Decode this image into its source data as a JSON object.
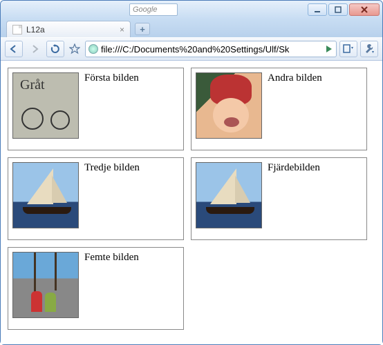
{
  "window": {
    "search_placeholder": "Google"
  },
  "tab": {
    "title": "L12a"
  },
  "toolbar": {
    "url": "file:///C:/Documents%20and%20Settings/Ulf/Sk"
  },
  "cards": [
    {
      "caption": "Första bilden"
    },
    {
      "caption": "Andra bilden"
    },
    {
      "caption": "Tredje bilden"
    },
    {
      "caption": "Fjärdebilden"
    },
    {
      "caption": "Femte bilden"
    }
  ]
}
